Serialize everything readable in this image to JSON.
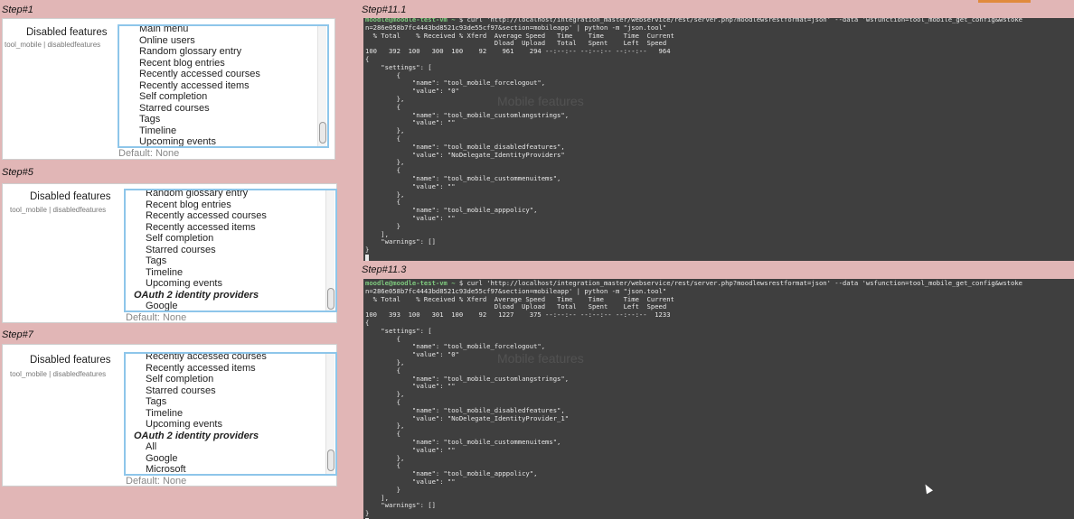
{
  "steps": {
    "s1": "Step#1",
    "s5": "Step#5",
    "s7": "Step#7",
    "s11_1": "Step#11.1",
    "s11_3": "Step#11.3"
  },
  "setting": {
    "name": "Disabled features",
    "id": "tool_mobile | disabledfeatures",
    "default": "Default: None"
  },
  "lists": {
    "s1": [
      "Main menu",
      "Online users",
      "Random glossary entry",
      "Recent blog entries",
      "Recently accessed courses",
      "Recently accessed items",
      "Self completion",
      "Starred courses",
      "Tags",
      "Timeline",
      "Upcoming events"
    ],
    "s5": [
      "Random glossary entry",
      "Recent blog entries",
      "Recently accessed courses",
      "Recently accessed items",
      "Self completion",
      "Starred courses",
      "Tags",
      "Timeline",
      "Upcoming events",
      "OAuth 2 identity providers",
      "Google"
    ],
    "s7": [
      "Recently accessed courses",
      "Recently accessed items",
      "Self completion",
      "Starred courses",
      "Tags",
      "Timeline",
      "Upcoming events",
      "OAuth 2 identity providers",
      "All",
      "Google",
      "Microsoft"
    ]
  },
  "terminal1": {
    "lines": [
      "moodle@moodle-test-vm ~ $ curl 'http://localhost/integration_master/webservice/rest/server.php?moodlewsrestformat=json' --data 'wsfunction=tool_mobile_get_config&wstoke",
      "n=286e058b7fc4443bd8521c93de55cf97&section=mobileapp' | python -m \"json.tool\"",
      "  % Total    % Received % Xferd  Average Speed   Time    Time     Time  Current",
      "                                 Dload  Upload   Total   Spent    Left  Speed",
      "100   392  100   300  100    92    961    294 --:--:-- --:--:-- --:--:--   964",
      "{",
      "    \"settings\": [",
      "        {",
      "            \"name\": \"tool_mobile_forcelogout\",",
      "            \"value\": \"0\"",
      "        },",
      "        {",
      "            \"name\": \"tool_mobile_customlangstrings\",",
      "            \"value\": \"\"",
      "        },",
      "        {",
      "            \"name\": \"tool_mobile_disabledfeatures\",",
      "            \"value\": \"NoDelegate_IdentityProviders\"",
      "        },",
      "        {",
      "            \"name\": \"tool_mobile_custommenuitems\",",
      "            \"value\": \"\"",
      "        },",
      "        {",
      "            \"name\": \"tool_mobile_apppolicy\",",
      "            \"value\": \"\"",
      "        }",
      "    ],",
      "    \"warnings\": []",
      "}"
    ],
    "ghost_title": "Mobile features"
  },
  "terminal3": {
    "lines": [
      "moodle@moodle-test-vm ~ $ curl 'http://localhost/integration_master/webservice/rest/server.php?moodlewsrestformat=json' --data 'wsfunction=tool_mobile_get_config&wstoke",
      "n=286e058b7fc4443bd8521c93de55cf97&section=mobileapp' | python -m \"json.tool\"",
      "  % Total    % Received % Xferd  Average Speed   Time    Time     Time  Current",
      "                                 Dload  Upload   Total   Spent    Left  Speed",
      "100   393  100   301  100    92   1227    375 --:--:-- --:--:-- --:--:--  1233",
      "{",
      "    \"settings\": [",
      "        {",
      "            \"name\": \"tool_mobile_forcelogout\",",
      "            \"value\": \"0\"",
      "        },",
      "        {",
      "            \"name\": \"tool_mobile_customlangstrings\",",
      "            \"value\": \"\"",
      "        },",
      "        {",
      "            \"name\": \"tool_mobile_disabledfeatures\",",
      "            \"value\": \"NoDelegate_IdentityProvider_1\"",
      "        },",
      "        {",
      "            \"name\": \"tool_mobile_custommenuitems\",",
      "            \"value\": \"\"",
      "        },",
      "        {",
      "            \"name\": \"tool_mobile_apppolicy\",",
      "            \"value\": \"\"",
      "        }",
      "    ],",
      "    \"warnings\": []",
      "}"
    ],
    "ghost_title": "Mobile features"
  }
}
